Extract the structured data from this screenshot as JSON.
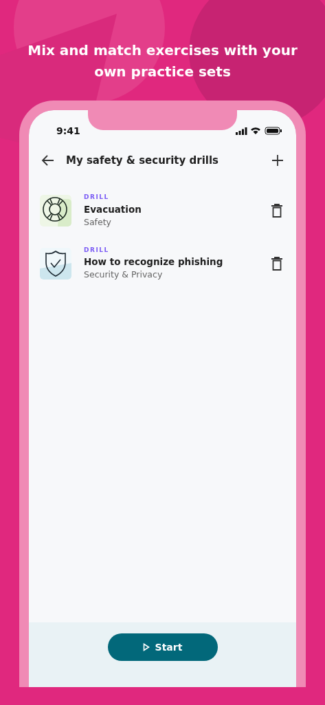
{
  "headline": "Mix and match exercises with your own practice sets",
  "status_bar": {
    "time": "9:41"
  },
  "header": {
    "title": "My safety & security drills"
  },
  "drills": [
    {
      "kind": "lifebuoy",
      "tag": "DRILL",
      "title": "Evacuation",
      "category": "Safety"
    },
    {
      "kind": "shield",
      "tag": "DRILL",
      "title": "How to recognize phishing",
      "category": "Security & Privacy"
    }
  ],
  "start_button": {
    "label": "Start"
  }
}
